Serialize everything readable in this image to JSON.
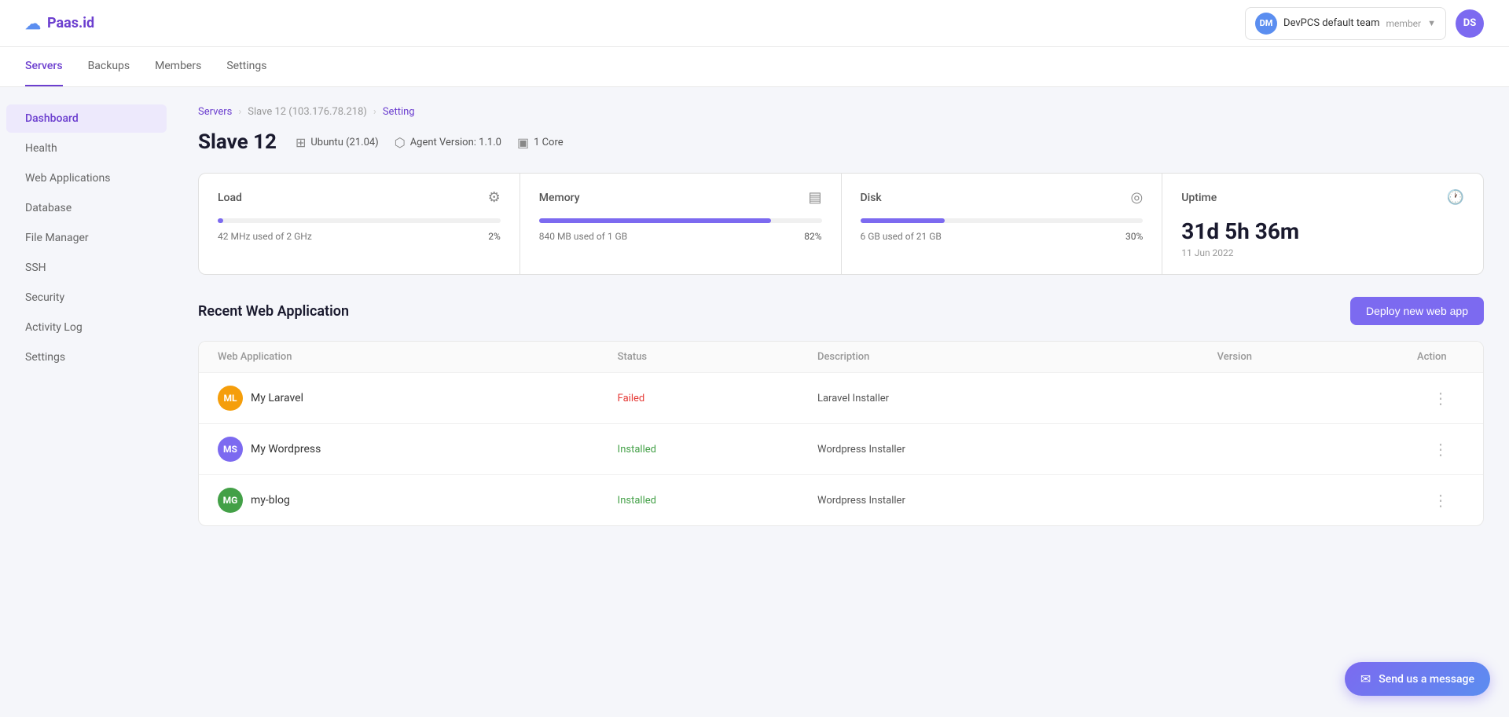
{
  "header": {
    "logo_text": "Paas.id",
    "team": {
      "avatar_initials": "DM",
      "name": "DevPCS default team",
      "role": "member"
    },
    "user_avatar": "DS"
  },
  "nav": {
    "tabs": [
      {
        "label": "Servers",
        "active": true
      },
      {
        "label": "Backups",
        "active": false
      },
      {
        "label": "Members",
        "active": false
      },
      {
        "label": "Settings",
        "active": false
      }
    ]
  },
  "sidebar": {
    "items": [
      {
        "id": "dashboard",
        "label": "Dashboard",
        "active": true
      },
      {
        "id": "health",
        "label": "Health",
        "active": false
      },
      {
        "id": "web-applications",
        "label": "Web Applications",
        "active": false
      },
      {
        "id": "database",
        "label": "Database",
        "active": false
      },
      {
        "id": "file-manager",
        "label": "File Manager",
        "active": false
      },
      {
        "id": "ssh",
        "label": "SSH",
        "active": false
      },
      {
        "id": "security",
        "label": "Security",
        "active": false
      },
      {
        "id": "activity-log",
        "label": "Activity Log",
        "active": false
      },
      {
        "id": "settings",
        "label": "Settings",
        "active": false
      }
    ]
  },
  "breadcrumb": {
    "servers": "Servers",
    "slave": "Slave 12 (103.176.78.218)",
    "setting": "Setting"
  },
  "server": {
    "title": "Slave 12",
    "os": "Ubuntu (21.04)",
    "agent_version": "Agent Version: 1.1.0",
    "cores": "1 Core"
  },
  "stats": {
    "load": {
      "label": "Load",
      "percent": 2,
      "used": "42 MHz",
      "total": "2 GHz",
      "display": "2%"
    },
    "memory": {
      "label": "Memory",
      "percent": 82,
      "used": "840 MB",
      "total": "1 GB",
      "display": "82%"
    },
    "disk": {
      "label": "Disk",
      "percent": 30,
      "used": "6 GB",
      "total": "21 GB",
      "display": "30%"
    },
    "uptime": {
      "label": "Uptime",
      "value": "31d 5h 36m",
      "since": "11 Jun 2022"
    }
  },
  "web_apps": {
    "section_title": "Recent Web Application",
    "deploy_button": "Deploy new web app",
    "columns": [
      "Web Application",
      "Status",
      "Description",
      "Version",
      "Action"
    ],
    "rows": [
      {
        "id": "my-laravel",
        "avatar_initials": "ML",
        "avatar_color": "#f59e0b",
        "name": "My Laravel",
        "status": "Failed",
        "status_type": "failed",
        "description": "Laravel Installer",
        "version": ""
      },
      {
        "id": "my-wordpress",
        "avatar_initials": "MS",
        "avatar_color": "#7c6af0",
        "name": "My Wordpress",
        "status": "Installed",
        "status_type": "installed",
        "description": "Wordpress Installer",
        "version": ""
      },
      {
        "id": "my-blog",
        "avatar_initials": "MG",
        "avatar_color": "#43a047",
        "name": "my-blog",
        "status": "Installed",
        "status_type": "installed",
        "description": "Wordpress Installer",
        "version": ""
      }
    ]
  },
  "chat_widget": {
    "label": "Send us a message"
  }
}
